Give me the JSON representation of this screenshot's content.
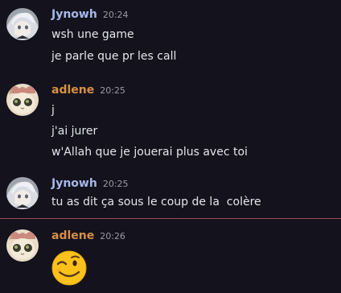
{
  "colors": {
    "background": "#13121d",
    "jynowh_name": "#a6b9ea",
    "adlene_name": "#d88f45",
    "new_message_divider": "#a1494d"
  },
  "messages": [
    {
      "author": "Jynowh",
      "timestamp": "20:24",
      "avatar_icon": "anime-character-avatar",
      "lines": [
        "wsh une game",
        "je parle que pr les call"
      ]
    },
    {
      "author": "adlene",
      "timestamp": "20:25",
      "avatar_icon": "cat-avatar",
      "lines": [
        "j",
        "j'ai jurer",
        "w'Allah que je jouerai plus avec toi"
      ]
    },
    {
      "author": "Jynowh",
      "timestamp": "20:25",
      "avatar_icon": "anime-character-avatar",
      "lines": [
        "tu as dit ça sous le coup de la  colère"
      ]
    },
    {
      "author": "adlene",
      "timestamp": "20:26",
      "avatar_icon": "cat-avatar",
      "emoji": "winking-face-emoji"
    }
  ]
}
